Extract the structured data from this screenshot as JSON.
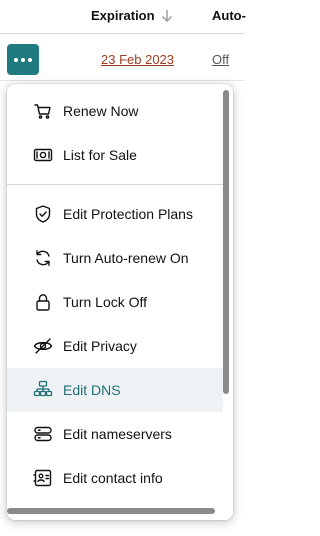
{
  "header": {
    "expiration_label": "Expiration",
    "auto_label": "Auto-"
  },
  "row": {
    "expiration_date": "23 Feb 2023",
    "auto_renew": "Off"
  },
  "menu": {
    "items": [
      {
        "label": "Renew Now",
        "icon": "cart-icon"
      },
      {
        "label": "List for Sale",
        "icon": "cash-icon"
      },
      {
        "label": "Edit Protection Plans",
        "icon": "shield-check-icon"
      },
      {
        "label": "Turn Auto-renew On",
        "icon": "refresh-icon"
      },
      {
        "label": "Turn Lock Off",
        "icon": "lock-icon"
      },
      {
        "label": "Edit Privacy",
        "icon": "eye-slash-icon"
      },
      {
        "label": "Edit DNS",
        "icon": "dns-icon"
      },
      {
        "label": "Edit nameservers",
        "icon": "server-icon"
      },
      {
        "label": "Edit contact info",
        "icon": "contact-card-icon"
      }
    ],
    "active_item": "Edit DNS"
  },
  "colors": {
    "accent": "#1f7a80",
    "date_link": "#9c3b1b",
    "active_bg": "#eef2f4"
  }
}
